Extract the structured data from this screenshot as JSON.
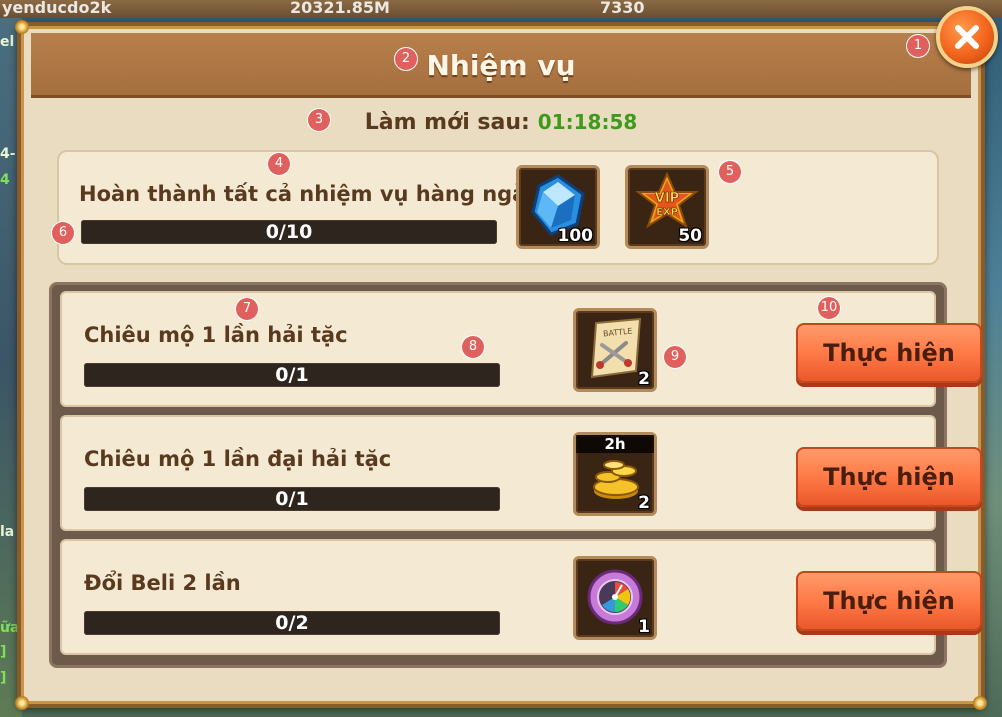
{
  "background": {
    "player_name": "yenducdo2k",
    "currency_1": "20321.85M",
    "currency_2": "7330",
    "left_edge_texts": [
      "el",
      "4-",
      "4",
      "la",
      "ữa",
      "]",
      "]"
    ]
  },
  "modal": {
    "title": "Nhiệm vụ",
    "close_icon": "close-x-icon",
    "refresh_label": "Làm mới sau:",
    "refresh_timer": "01:18:58"
  },
  "daily": {
    "title": "Hoàn thành tất cả nhiệm vụ hàng ngày",
    "progress_text": "0/10",
    "progress_fraction": 0,
    "rewards": [
      {
        "icon": "blue-gem-icon",
        "qty": "100"
      },
      {
        "icon": "vip-exp-icon",
        "qty": "50"
      }
    ]
  },
  "quests": [
    {
      "title": "Chiêu mộ 1 lần hải tặc",
      "progress_text": "0/1",
      "progress_fraction": 0,
      "reward_icon": "battle-scroll-icon",
      "reward_qty": "2",
      "reward_tag": "",
      "button": "Thực hiện"
    },
    {
      "title": "Chiêu mộ 1 lần đại hải tặc",
      "progress_text": "0/1",
      "progress_fraction": 0,
      "reward_icon": "gold-coins-icon",
      "reward_qty": "2",
      "reward_tag": "2h",
      "button": "Thực hiện"
    },
    {
      "title": "Đổi Beli 2 lần",
      "progress_text": "0/2",
      "progress_fraction": 0,
      "reward_icon": "compass-icon",
      "reward_qty": "1",
      "reward_tag": "",
      "button": "Thực hiện"
    }
  ],
  "badges": [
    "1",
    "2",
    "3",
    "4",
    "5",
    "6",
    "7",
    "8",
    "9",
    "10"
  ],
  "colors": {
    "accent_button": "#ff7a47",
    "timer": "#3d9a1a",
    "panel": "#e9dcc1"
  }
}
